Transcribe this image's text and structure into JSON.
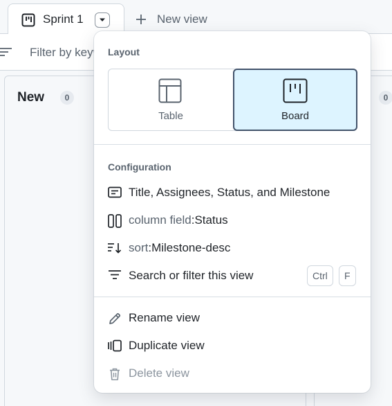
{
  "tabs": {
    "active_label": "Sprint 1",
    "new_view_label": "New view"
  },
  "filter": {
    "placeholder": "Filter by keyword or by field"
  },
  "board": {
    "columns": [
      {
        "title": "New",
        "count": "0"
      },
      {
        "title": "",
        "count": "0"
      }
    ]
  },
  "popover": {
    "layout_heading": "Layout",
    "layout_options": {
      "table": "Table",
      "board": "Board",
      "selected": "Board"
    },
    "configuration_heading": "Configuration",
    "fields_label": "Title, Assignees, Status, and Milestone",
    "column_field_key": "column field",
    "column_field_sep": ":",
    "column_field_value": "Status",
    "sort_key": "sort",
    "sort_sep": ":",
    "sort_value": "Milestone-desc",
    "search_label": "Search or filter this view",
    "shortcut_keys": [
      "Ctrl",
      "F"
    ],
    "rename_label": "Rename view",
    "duplicate_label": "Duplicate view",
    "delete_label": "Delete view"
  },
  "colors": {
    "accent_selected_bg": "#ddf4ff",
    "accent_selected_border": "#41526a",
    "muted_text": "#59636e",
    "disabled_text": "#8c959f"
  },
  "icons": [
    "board-icon",
    "chevron-down-icon",
    "plus-icon",
    "filter-icon",
    "table-icon",
    "board-layout-icon",
    "fields-icon",
    "column-field-icon",
    "sort-desc-icon",
    "filter-lines-icon",
    "pencil-icon",
    "duplicate-icon",
    "trash-icon"
  ]
}
